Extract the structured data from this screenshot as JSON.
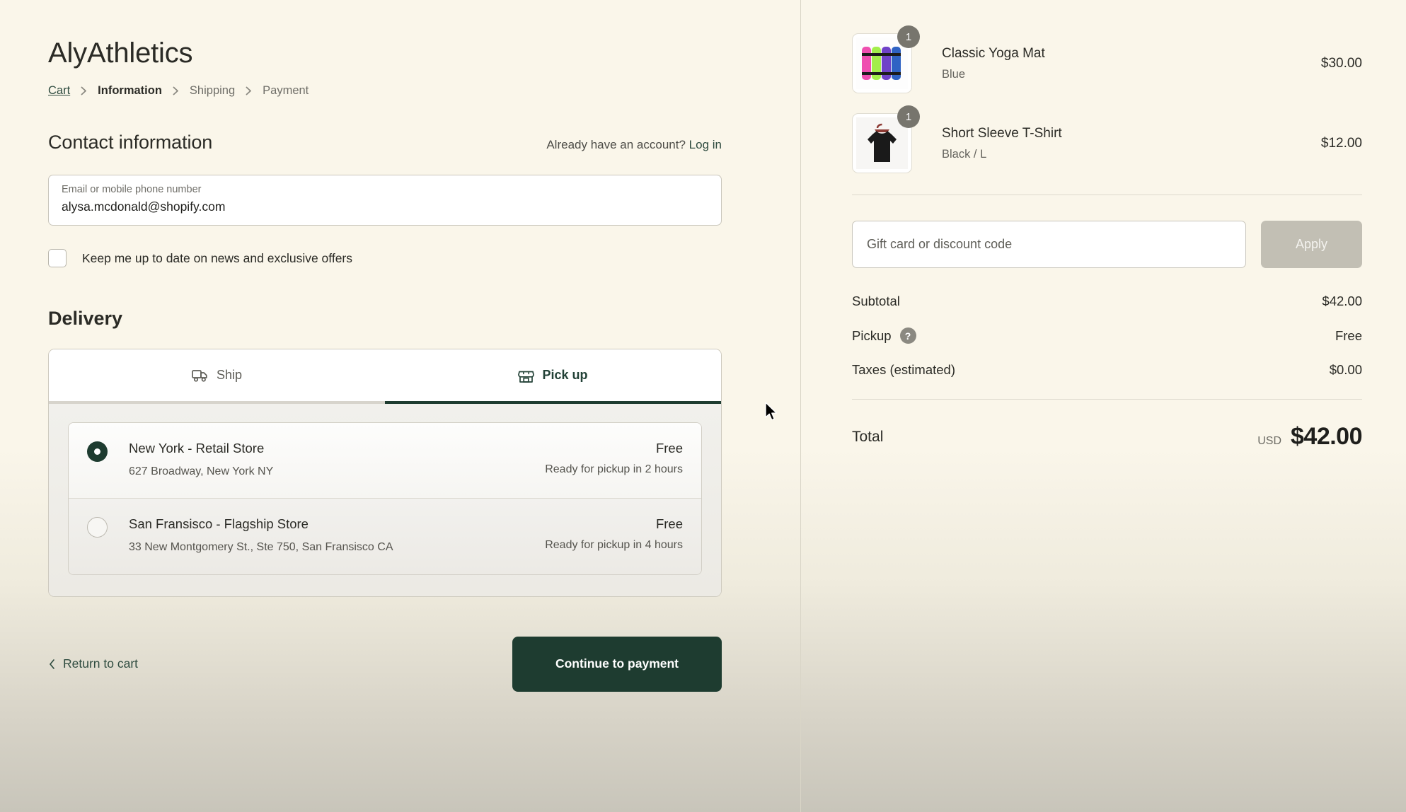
{
  "brand": {
    "title": "AlyAthletics"
  },
  "breadcrumb": {
    "items": [
      {
        "label": "Cart",
        "state": "link"
      },
      {
        "label": "Information",
        "state": "current"
      },
      {
        "label": "Shipping",
        "state": "muted"
      },
      {
        "label": "Payment",
        "state": "muted"
      }
    ]
  },
  "contact": {
    "title": "Contact information",
    "account_prompt": "Already have an account?",
    "login_label": "Log in",
    "email_label": "Email or mobile phone number",
    "email_value": "alysa.mcdonald@shopify.com",
    "newsletter_label": "Keep me up to date on news and exclusive offers",
    "newsletter_checked": false
  },
  "delivery": {
    "title": "Delivery",
    "tabs": [
      {
        "label": "Ship",
        "icon": "truck-icon",
        "active": false
      },
      {
        "label": "Pick up",
        "icon": "store-icon",
        "active": true
      }
    ],
    "options": [
      {
        "name": "New York - Retail Store",
        "address": "627 Broadway, New York NY",
        "price": "Free",
        "eta": "Ready for pickup in 2 hours",
        "selected": true
      },
      {
        "name": "San Fransisco - Flagship Store",
        "address": "33 New Montgomery St., Ste 750, San Fransisco CA",
        "price": "Free",
        "eta": "Ready for pickup in 4 hours",
        "selected": false
      }
    ]
  },
  "actions": {
    "return_label": "Return to cart",
    "continue_label": "Continue to payment"
  },
  "summary": {
    "items": [
      {
        "name": "Classic Yoga Mat",
        "variant": "Blue",
        "price": "$30.00",
        "qty": "1",
        "image": "yoga-mat-rolls"
      },
      {
        "name": "Short Sleeve T-Shirt",
        "variant": "Black / L",
        "price": "$12.00",
        "qty": "1",
        "image": "black-tshirt-on-hanger"
      }
    ],
    "discount_placeholder": "Gift card or discount code",
    "discount_value": "",
    "apply_label": "Apply",
    "rows": [
      {
        "label": "Subtotal",
        "value": "$42.00",
        "help": false
      },
      {
        "label": "Pickup",
        "value": "Free",
        "help": true
      },
      {
        "label": "Taxes (estimated)",
        "value": "$0.00",
        "help": false
      }
    ],
    "total_label": "Total",
    "total_currency": "USD",
    "total_amount": "$42.00"
  },
  "colors": {
    "brand_green": "#1e3c30",
    "link_green": "#2e4b3f",
    "page_bg": "#faf6ea",
    "badge_gray": "#77756d",
    "apply_gray": "#c2bfb4"
  }
}
